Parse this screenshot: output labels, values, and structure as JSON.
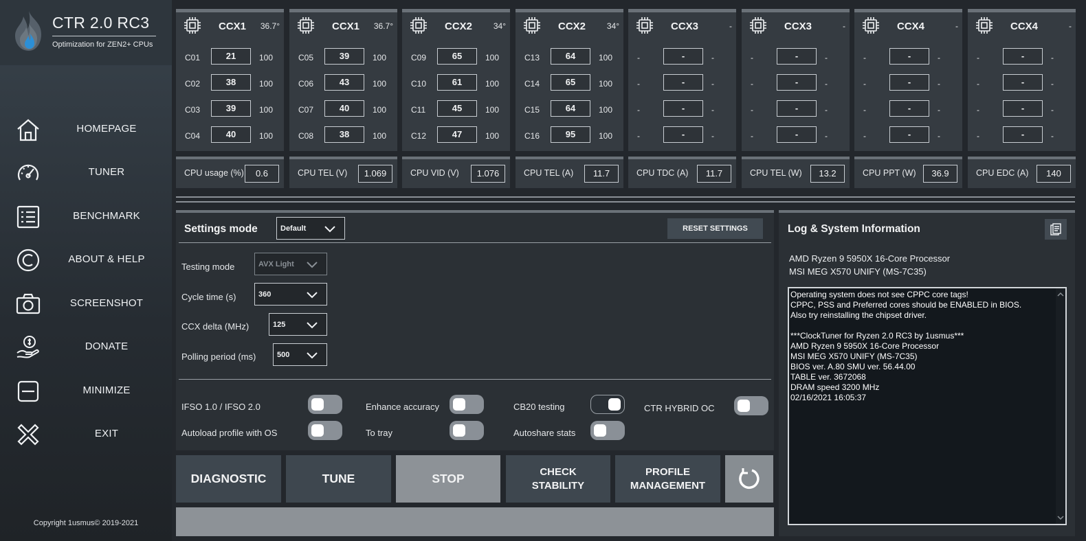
{
  "app": {
    "title": "CTR 2.0 RC3",
    "subtitle": "Optimization for ZEN2+ CPUs",
    "copyright": "Copyright 1usmus© 2019-2021"
  },
  "nav": [
    {
      "label": "HOMEPAGE",
      "icon": "home-icon"
    },
    {
      "label": "TUNER",
      "icon": "gauge-icon"
    },
    {
      "label": "BENCHMARK",
      "icon": "list-icon"
    },
    {
      "label": "ABOUT & HELP",
      "icon": "copyright-icon"
    },
    {
      "label": "SCREENSHOT",
      "icon": "camera-icon"
    },
    {
      "label": "DONATE",
      "icon": "donate-icon"
    },
    {
      "label": "MINIMIZE",
      "icon": "minimize-icon"
    },
    {
      "label": "EXIT",
      "icon": "exit-icon"
    }
  ],
  "ccx": [
    {
      "name": "CCX1",
      "temp": "36.7°",
      "cores": [
        {
          "label": "C01",
          "value": "21",
          "max": "100"
        },
        {
          "label": "C02",
          "value": "38",
          "max": "100"
        },
        {
          "label": "C03",
          "value": "39",
          "max": "100"
        },
        {
          "label": "C04",
          "value": "40",
          "max": "100"
        }
      ]
    },
    {
      "name": "CCX1",
      "temp": "36.7°",
      "cores": [
        {
          "label": "C05",
          "value": "39",
          "max": "100"
        },
        {
          "label": "C06",
          "value": "43",
          "max": "100"
        },
        {
          "label": "C07",
          "value": "40",
          "max": "100"
        },
        {
          "label": "C08",
          "value": "38",
          "max": "100"
        }
      ]
    },
    {
      "name": "CCX2",
      "temp": "34°",
      "cores": [
        {
          "label": "C09",
          "value": "65",
          "max": "100"
        },
        {
          "label": "C10",
          "value": "61",
          "max": "100"
        },
        {
          "label": "C11",
          "value": "45",
          "max": "100"
        },
        {
          "label": "C12",
          "value": "47",
          "max": "100"
        }
      ]
    },
    {
      "name": "CCX2",
      "temp": "34°",
      "cores": [
        {
          "label": "C13",
          "value": "64",
          "max": "100"
        },
        {
          "label": "C14",
          "value": "65",
          "max": "100"
        },
        {
          "label": "C15",
          "value": "64",
          "max": "100"
        },
        {
          "label": "C16",
          "value": "95",
          "max": "100"
        }
      ]
    },
    {
      "name": "CCX3",
      "temp": "-",
      "cores": [
        {
          "label": "-",
          "value": "-",
          "max": "-"
        },
        {
          "label": "-",
          "value": "-",
          "max": "-"
        },
        {
          "label": "-",
          "value": "-",
          "max": "-"
        },
        {
          "label": "-",
          "value": "-",
          "max": "-"
        }
      ]
    },
    {
      "name": "CCX3",
      "temp": "-",
      "cores": [
        {
          "label": "-",
          "value": "-",
          "max": "-"
        },
        {
          "label": "-",
          "value": "-",
          "max": "-"
        },
        {
          "label": "-",
          "value": "-",
          "max": "-"
        },
        {
          "label": "-",
          "value": "-",
          "max": "-"
        }
      ]
    },
    {
      "name": "CCX4",
      "temp": "-",
      "cores": [
        {
          "label": "-",
          "value": "-",
          "max": "-"
        },
        {
          "label": "-",
          "value": "-",
          "max": "-"
        },
        {
          "label": "-",
          "value": "-",
          "max": "-"
        },
        {
          "label": "-",
          "value": "-",
          "max": "-"
        }
      ]
    },
    {
      "name": "CCX4",
      "temp": "-",
      "cores": [
        {
          "label": "-",
          "value": "-",
          "max": "-"
        },
        {
          "label": "-",
          "value": "-",
          "max": "-"
        },
        {
          "label": "-",
          "value": "-",
          "max": "-"
        },
        {
          "label": "-",
          "value": "-",
          "max": "-"
        }
      ]
    }
  ],
  "metrics": [
    {
      "label": "CPU usage (%)",
      "value": "0.6"
    },
    {
      "label": "CPU TEL (V)",
      "value": "1.069"
    },
    {
      "label": "CPU VID (V)",
      "value": "1.076"
    },
    {
      "label": "CPU TEL (A)",
      "value": "11.7"
    },
    {
      "label": "CPU TDC (A)",
      "value": "11.7"
    },
    {
      "label": "CPU TEL (W)",
      "value": "13.2"
    },
    {
      "label": "CPU PPT (W)",
      "value": "36.9"
    },
    {
      "label": "CPU EDC (A)",
      "value": "140"
    }
  ],
  "settings": {
    "title": "Settings mode",
    "mode": "Default",
    "reset_label": "RESET SETTINGS",
    "fields": [
      {
        "label": "Testing mode",
        "value": "AVX Light",
        "disabled": true
      },
      {
        "label": "Cycle time (s)",
        "value": "360"
      },
      {
        "label": "CCX delta (MHz)",
        "value": "125"
      },
      {
        "label": "Polling period (ms)",
        "value": "500"
      }
    ],
    "toggles": [
      {
        "label": "IFSO 1.0 / IFSO 2.0",
        "on": false
      },
      {
        "label": "Enhance accuracy",
        "on": false
      },
      {
        "label": "CB20 testing",
        "on": true
      },
      {
        "label": "CTR HYBRID OC",
        "on": false
      },
      {
        "label": "Autoload profile with OS",
        "on": false
      },
      {
        "label": "To tray",
        "on": false
      },
      {
        "label": "Autoshare stats",
        "on": false
      }
    ]
  },
  "actions": {
    "diagnostic": "DIAGNOSTIC",
    "tune": "TUNE",
    "stop": "STOP",
    "check1": "CHECK",
    "check2": "STABILITY",
    "profile1": "PROFILE",
    "profile2": "MANAGEMENT"
  },
  "log": {
    "title": "Log & System Information",
    "cpu": "AMD Ryzen 9 5950X 16-Core Processor",
    "board": "MSI MEG X570 UNIFY (MS-7C35)",
    "lines": [
      "Operating system does not see CPPC core tags!",
      "CPPC, PSS and Preferred cores should be ENABLED in BIOS.",
      "Also try reinstalling the chipset driver.",
      "",
      "***ClockTuner for Ryzen 2.0 RC3 by 1usmus***",
      "AMD Ryzen 9 5950X 16-Core Processor",
      "MSI MEG X570 UNIFY (MS-7C35)",
      "BIOS ver. A.80 SMU ver. 56.44.00",
      "TABLE ver. 3672068",
      "DRAM speed 3200 MHz",
      "02/16/2021 16:05:37"
    ]
  },
  "colors": {
    "background": "#23272c",
    "panel": "#353b41",
    "panel_top": "#6a7178",
    "button": "#3e474f",
    "stop_button": "#8d9297",
    "flame_blue": "#2c8fd6"
  }
}
